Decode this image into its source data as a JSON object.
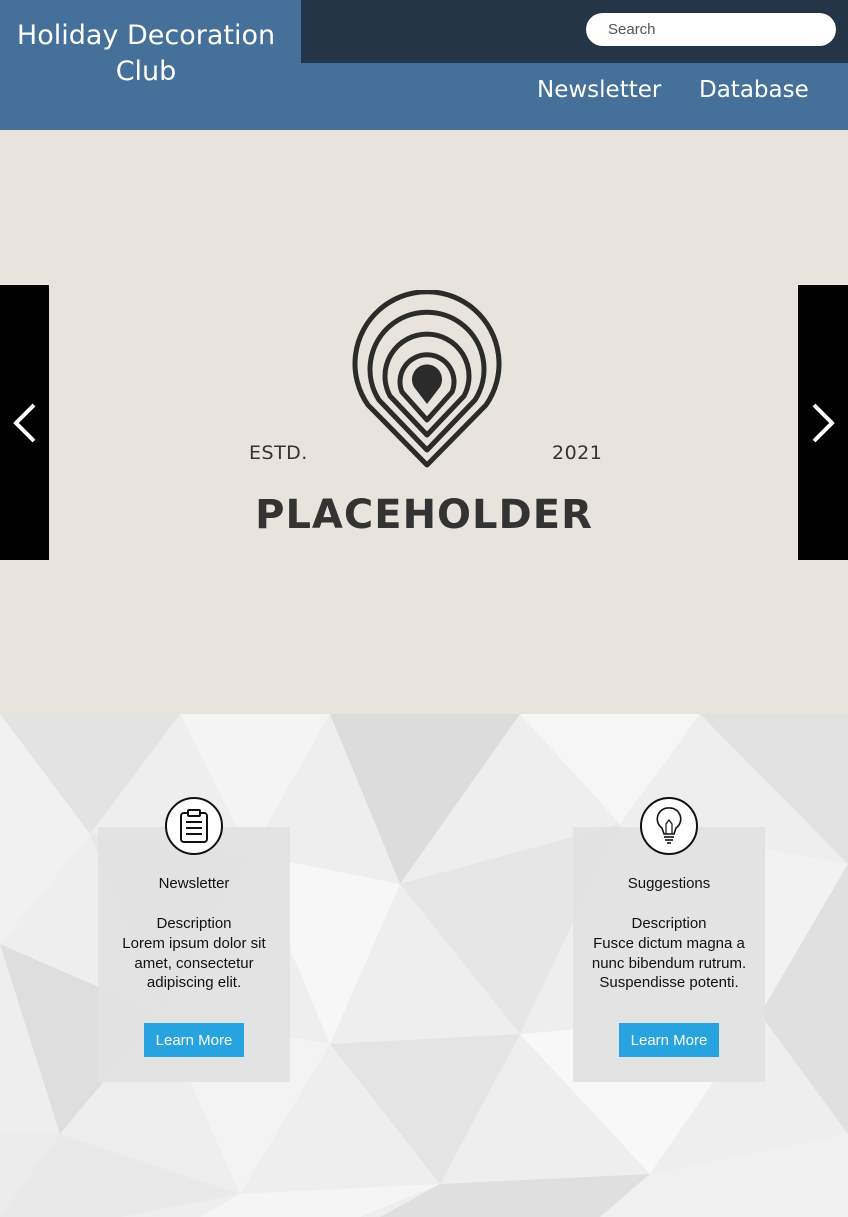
{
  "header": {
    "site_title": "Holiday Decoration Club",
    "search_placeholder": "Search",
    "nav": [
      {
        "label": "Newsletter"
      },
      {
        "label": "Database"
      }
    ]
  },
  "hero": {
    "logo_estd": "ESTD.",
    "logo_year": "2021",
    "logo_text": "PLACEHOLDER",
    "prev_icon": "chevron-left-icon",
    "next_icon": "chevron-right-icon"
  },
  "features": [
    {
      "icon": "clipboard-icon",
      "title": "Newsletter",
      "desc_label": "Description",
      "desc": "Lorem ipsum dolor sit amet, consectetur adipiscing elit.",
      "button": "Learn More"
    },
    {
      "icon": "lightbulb-icon",
      "title": "Suggestions",
      "desc_label": "Description",
      "desc": "Fusce dictum magna a nunc bibendum rutrum. Suspendisse potenti.",
      "button": "Learn More"
    }
  ],
  "colors": {
    "header_bg": "#44709a",
    "topbar_bg": "#243548",
    "hero_bg": "#e8e3dc",
    "button_bg": "#27a3e0"
  }
}
